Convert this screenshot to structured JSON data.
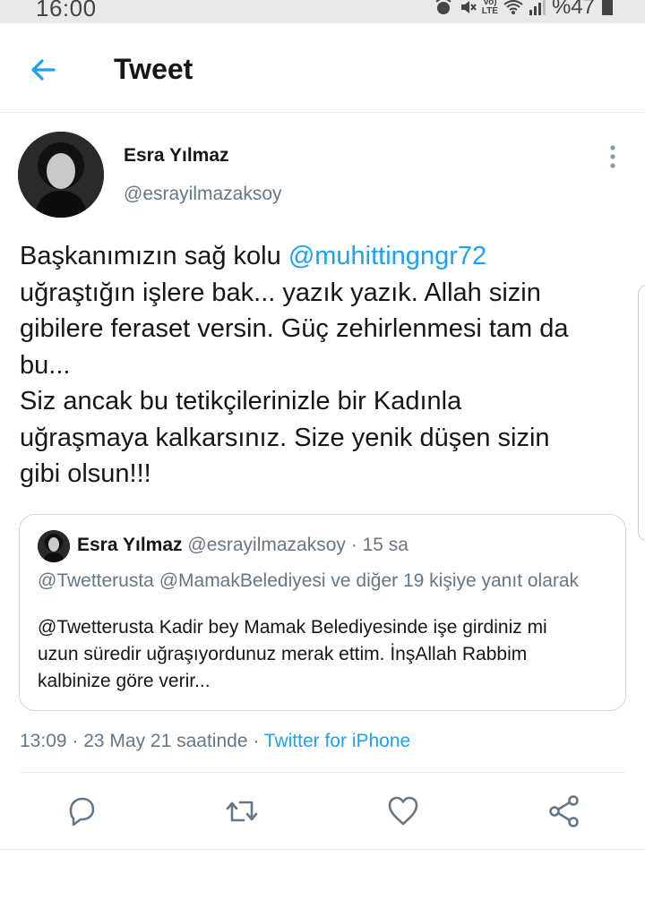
{
  "status_bar": {
    "time": "16:00",
    "network_top": "Vo)",
    "network_bottom": "LTE",
    "battery": "%47",
    "icons": [
      "alarm-icon",
      "mute-icon",
      "wifi-icon",
      "signal-icon",
      "battery-icon"
    ]
  },
  "header": {
    "title": "Tweet",
    "back_icon": "arrow-left-icon"
  },
  "author": {
    "name": "Esra Yılmaz",
    "handle": "@esrayilmazaksoy"
  },
  "tweet": {
    "lines": [
      {
        "pre": "Başkanımızın sağ kolu ",
        "mention": "@muhittingngr72"
      },
      {
        "text": "uğraştığın işlere bak... yazık yazık. Allah sizin"
      },
      {
        "text": "gibilere feraset versin. Güç zehirlenmesi tam da"
      },
      {
        "text": "bu..."
      },
      {
        "text": "Siz ancak bu tetikçilerinizle bir Kadınla"
      },
      {
        "text": "uğraşmaya kalkarsınız. Size yenik düşen sizin"
      },
      {
        "text": "gibi olsun!!!"
      }
    ]
  },
  "quote": {
    "name": "Esra Yılmaz",
    "handle_time": "@esrayilmazaksoy · 15 sa",
    "reply_to": "@Twetterusta @MamakBelediyesi ve diğer 19 kişiye yanıt olarak",
    "lines": [
      "@Twetterusta Kadir bey Mamak Belediyesinde işe girdiniz mi",
      "uzun süredir uğraşıyordunuz merak ettim. İnşAllah Rabbim",
      "kalbinize göre verir..."
    ]
  },
  "meta": {
    "datetime": "13:09 · 23 May 21 saatinde · ",
    "source": "Twitter for iPhone"
  },
  "actions": [
    "reply-icon",
    "retweet-icon",
    "like-icon",
    "share-icon"
  ],
  "colors": {
    "accent": "#1da1f2",
    "secondary_text": "#657786",
    "primary_text": "#14171a"
  }
}
